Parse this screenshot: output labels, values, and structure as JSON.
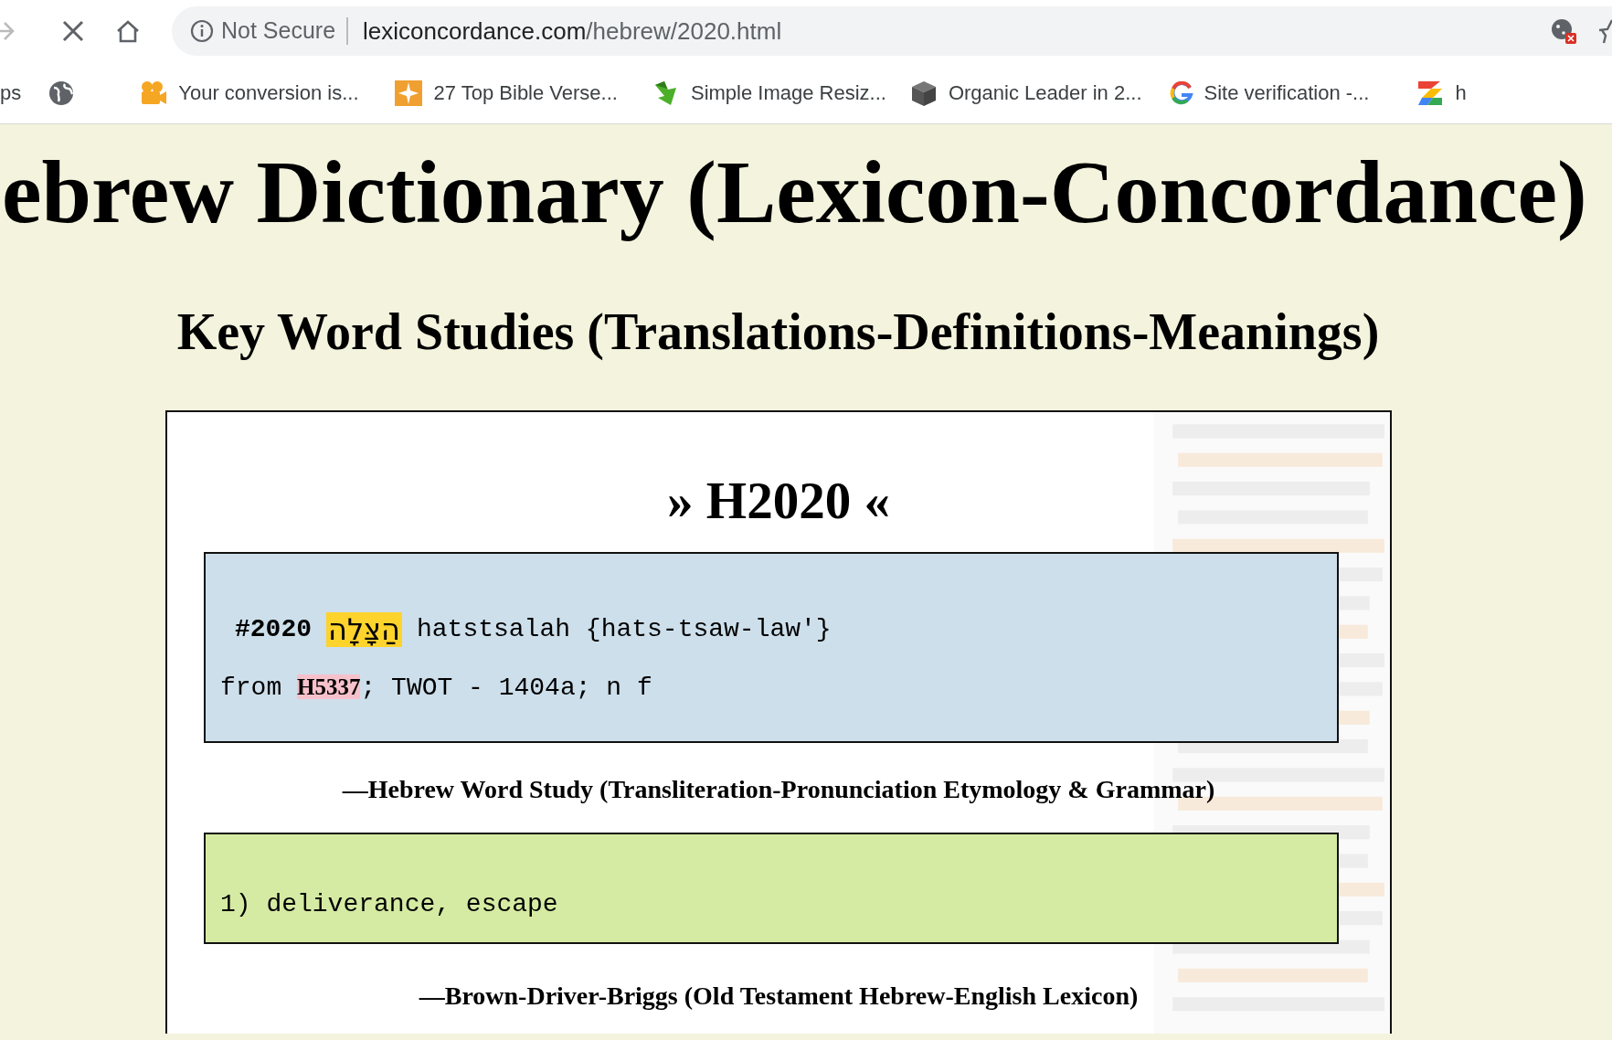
{
  "browser": {
    "address": {
      "security_label": "Not Secure",
      "url_host": "lexiconcordance.com",
      "url_path": "/hebrew/2020.html"
    },
    "bookmarks": [
      {
        "kind": "text_only",
        "label": "ps"
      },
      {
        "kind": "icon_only"
      },
      {
        "kind": "icon_text",
        "label": "Your conversion is..."
      },
      {
        "kind": "icon_text",
        "label": "27 Top Bible Verse..."
      },
      {
        "kind": "icon_text",
        "label": "Simple Image Resiz..."
      },
      {
        "kind": "icon_text",
        "label": "Organic Leader in 2..."
      },
      {
        "kind": "icon_text",
        "label": "Site verification -..."
      },
      {
        "kind": "icon_text",
        "label": "h"
      }
    ]
  },
  "page": {
    "title": "ebrew Dictionary (Lexicon-Concordance)",
    "subtitle": "Key Word Studies (Translations-Definitions-Meanings)",
    "entry": {
      "heading": "» H2020 «",
      "word_study": {
        "number": "#2020",
        "hebrew": "הַצָּלָה",
        "transliteration": "hatstsalah {hats-tsaw-law'}",
        "from": "from",
        "reference": "H5337",
        "derivation": "; TWOT - 1404a; n f"
      },
      "word_study_caption": "—Hebrew Word Study (Transliteration-Pronunciation Etymology & Grammar)",
      "definitions": [
        "1) deliverance, escape"
      ],
      "definitions_caption": "—Brown-Driver-Briggs (Old Testament Hebrew-English Lexicon)"
    }
  }
}
